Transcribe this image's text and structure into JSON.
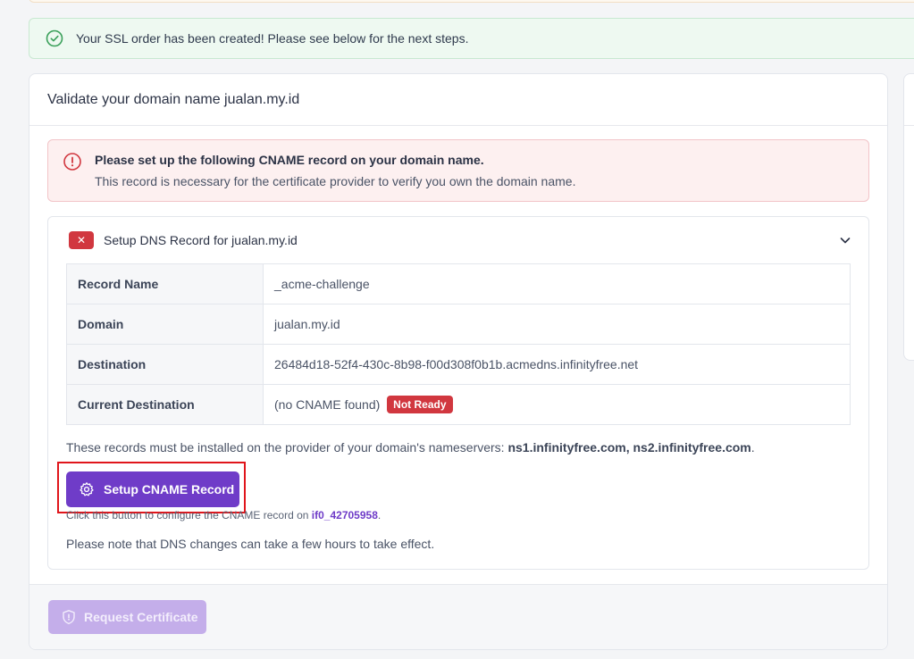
{
  "success_alert": {
    "message": "Your SSL order has been created! Please see below for the next steps.",
    "icon": "check-circle-icon",
    "color": "#3aa05a"
  },
  "card": {
    "title": "Validate your domain name jualan.my.id"
  },
  "danger_alert": {
    "title": "Please set up the following CNAME record on your domain name.",
    "body": "This record is necessary for the certificate provider to verify you own the domain name.",
    "icon": "exclamation-circle-icon",
    "color": "#d1373f"
  },
  "dns_panel": {
    "status_icon": "x-icon",
    "status_symbol": "✕",
    "title": "Setup DNS Record for jualan.my.id",
    "toggle_icon": "chevron-down-icon",
    "rows": [
      {
        "label": "Record Name",
        "value": "_acme-challenge"
      },
      {
        "label": "Domain",
        "value": "jualan.my.id"
      },
      {
        "label": "Destination",
        "value": "26484d18-52f4-430c-8b98-f00d308f0b1b.acmedns.infinityfree.net"
      },
      {
        "label": "Current Destination",
        "value": "(no CNAME found)",
        "badge": "Not Ready"
      }
    ],
    "ns_prefix": "These records must be installed on the provider of your domain's nameservers: ",
    "ns_values": "ns1.infinityfree.com, ns2.infinityfree.com",
    "ns_suffix": ".",
    "setup_button": "Setup CNAME Record",
    "setup_icon": "gear-icon",
    "helper_prefix": "Click this button to configure the CNAME record on ",
    "helper_link": "if0_42705958",
    "helper_suffix": ".",
    "note": "Please note that DNS changes can take a few hours to take effect."
  },
  "footer": {
    "request_button": "Request Certificate",
    "request_icon": "shield-icon"
  },
  "colors": {
    "primary": "#6f3cc8",
    "primary_disabled": "#c4aeea",
    "danger": "#d1373f",
    "highlight": "#e0151b"
  }
}
